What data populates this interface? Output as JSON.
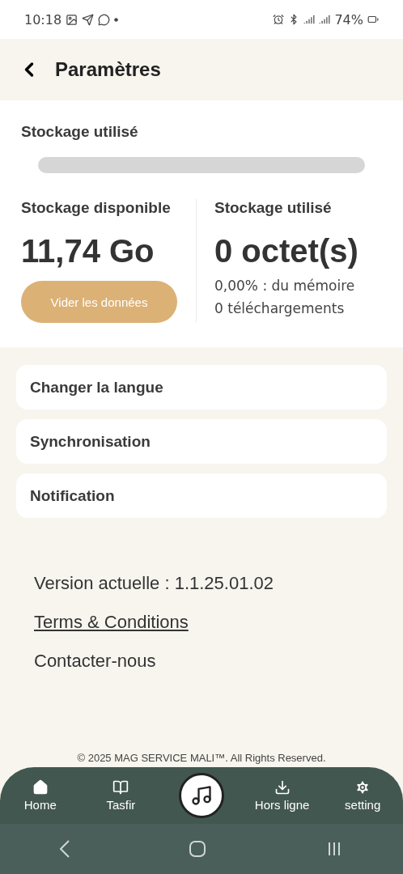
{
  "status_bar": {
    "time": "10:18",
    "battery": "74%"
  },
  "header": {
    "title": "Paramètres"
  },
  "storage": {
    "title": "Stockage utilisé",
    "available": {
      "label": "Stockage disponible",
      "value": "11,74 Go",
      "button": "Vider les données"
    },
    "used": {
      "label": "Stockage utilisé",
      "value": "0 octet(s)",
      "percent": "0,00% : du mémoire",
      "downloads": "0 téléchargements"
    }
  },
  "menu": [
    {
      "label": "Changer la langue"
    },
    {
      "label": "Synchronisation"
    },
    {
      "label": "Notification"
    }
  ],
  "info": {
    "version": "Version actuelle : 1.1.25.01.02",
    "terms": "Terms & Conditions",
    "contact": "Contacter-nous"
  },
  "copyright": "© 2025 MAG SERVICE MALI™. All Rights Reserved.",
  "bottom_nav": [
    {
      "label": "Home",
      "kind": "home"
    },
    {
      "label": "Tasfir",
      "kind": "book"
    },
    {
      "kind": "player"
    },
    {
      "label": "Hors ligne",
      "kind": "download"
    },
    {
      "label": "setting",
      "kind": "settings"
    }
  ]
}
